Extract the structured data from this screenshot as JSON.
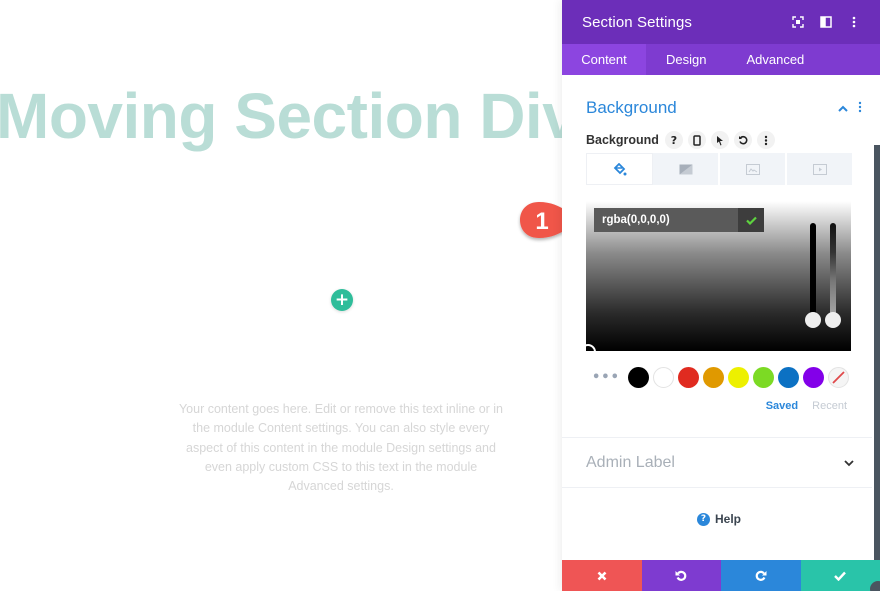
{
  "canvas": {
    "hero_title": "Moving Section Divi",
    "add_button_icon": "plus-icon",
    "body_text": "Your content goes here. Edit or remove this text inline or in the module Content settings. You can also style every aspect of this content in the module Design settings and even apply custom CSS to this text in the module Advanced settings."
  },
  "callout": {
    "number": "1",
    "color": "#f0564a"
  },
  "panel": {
    "title": "Section Settings",
    "header_icons": [
      "focus-icon",
      "split-view-icon",
      "more-vertical-icon"
    ],
    "tabs": [
      {
        "label": "Content",
        "active": true
      },
      {
        "label": "Design",
        "active": false
      },
      {
        "label": "Advanced",
        "active": false
      }
    ],
    "section": {
      "title": "Background",
      "expanded": true
    },
    "background_field": {
      "label": "Background",
      "icons": [
        "help-icon",
        "mobile-icon",
        "hover-pointer-icon",
        "reset-icon",
        "more-vertical-icon"
      ],
      "type_tabs": [
        {
          "icon": "paint-bucket-icon",
          "active": true
        },
        {
          "icon": "gradient-icon",
          "active": false
        },
        {
          "icon": "image-icon",
          "active": false
        },
        {
          "icon": "video-icon",
          "active": false
        }
      ]
    },
    "color_picker": {
      "value": "rgba(0,0,0,0)",
      "confirm_icon": "check-icon",
      "swatches": [
        "#000000",
        "#ffffff",
        "#e02b20",
        "#e09900",
        "#edf000",
        "#7cda24",
        "#0c71c3",
        "#8300e9"
      ],
      "clear_swatch_icon": "no-color-icon",
      "saved_label": "Saved",
      "recent_label": "Recent"
    },
    "admin_label": {
      "title": "Admin Label",
      "expanded": false
    },
    "help_label": "Help",
    "footer": [
      {
        "name": "cancel",
        "icon": "close-icon",
        "color": "#ef5555"
      },
      {
        "name": "undo",
        "icon": "undo-icon",
        "color": "#7e3bd0"
      },
      {
        "name": "redo",
        "icon": "redo-icon",
        "color": "#2b87da"
      },
      {
        "name": "save",
        "icon": "check-icon",
        "color": "#29c4a9"
      }
    ]
  }
}
